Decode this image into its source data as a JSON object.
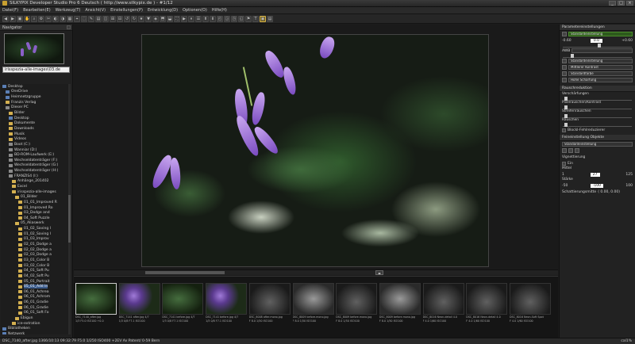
{
  "window": {
    "title": "SILKYPIX Developer Studio Pro 6 Deutsch ( http://www.silkypix.de ) - #1/12",
    "controls": [
      "_",
      "□",
      "×"
    ]
  },
  "menu": [
    "Datei(F)",
    "Bearbeiten(E)",
    "Werkzeug(T)",
    "Ansicht(V)",
    "Einstellungen(P)",
    "Entwicklung(D)",
    "Optionen(O)",
    "Hilfe(H)"
  ],
  "left": {
    "navigator_title": "Navigator",
    "folder_value": "irisspezia-alle-images\\03.de",
    "tree": [
      {
        "label": "Desktop",
        "icon": "b",
        "indent": 0
      },
      {
        "label": "OneDrive",
        "icon": "b",
        "indent": 1
      },
      {
        "label": "Heimnetzgruppe",
        "icon": "b",
        "indent": 1
      },
      {
        "label": "Franzis Verlag",
        "icon": "f",
        "indent": 1
      },
      {
        "label": "Dieser PC",
        "icon": "d",
        "indent": 1
      },
      {
        "label": "Bilder",
        "icon": "f",
        "indent": 2
      },
      {
        "label": "Desktop",
        "icon": "b",
        "indent": 2
      },
      {
        "label": "Dokumente",
        "icon": "f",
        "indent": 2
      },
      {
        "label": "Downloads",
        "icon": "f",
        "indent": 2
      },
      {
        "label": "Musik",
        "icon": "f",
        "indent": 2
      },
      {
        "label": "Videos",
        "icon": "f",
        "indent": 2
      },
      {
        "label": "Boot (C:)",
        "icon": "d",
        "indent": 2
      },
      {
        "label": "Wanniar (D:)",
        "icon": "d",
        "indent": 2
      },
      {
        "label": "BD-ROM-Laufwerk (E:)",
        "icon": "d",
        "indent": 2
      },
      {
        "label": "Wechseldatenträger (F:)",
        "icon": "d",
        "indent": 2
      },
      {
        "label": "Wechseldatenträger (G:)",
        "icon": "d",
        "indent": 2
      },
      {
        "label": "Wechseldatenträger (H:)",
        "icon": "d",
        "indent": 2
      },
      {
        "label": "FRANZIS4 (I:)",
        "icon": "d",
        "indent": 2
      },
      {
        "label": "Anhänge_201402",
        "icon": "f",
        "indent": 3
      },
      {
        "label": "Excel",
        "icon": "f",
        "indent": 3
      },
      {
        "label": "irisspezia-alle-images",
        "icon": "f",
        "indent": 3
      },
      {
        "label": "01_Bilder",
        "icon": "f",
        "indent": 4
      },
      {
        "label": "01_01_Improved R",
        "icon": "f",
        "indent": 5
      },
      {
        "label": "01_Improved Ro",
        "icon": "f",
        "indent": 5
      },
      {
        "label": "03_Dodge and",
        "icon": "f",
        "indent": 5
      },
      {
        "label": "04_Soft Puzzle",
        "icon": "f",
        "indent": 5
      },
      {
        "label": "05_Aliaswerk",
        "icon": "f",
        "indent": 4
      },
      {
        "label": "01_02_Saving I",
        "icon": "f",
        "indent": 5
      },
      {
        "label": "01_02_Saving I",
        "icon": "f",
        "indent": 5
      },
      {
        "label": "01_03_Improv",
        "icon": "f",
        "indent": 5
      },
      {
        "label": "02_01_Dodge a",
        "icon": "f",
        "indent": 5
      },
      {
        "label": "02_02_Dodge a",
        "icon": "f",
        "indent": 5
      },
      {
        "label": "02_03_Dodge a",
        "icon": "f",
        "indent": 5
      },
      {
        "label": "03_01_Color B",
        "icon": "f",
        "indent": 5
      },
      {
        "label": "03_02_Color B",
        "icon": "f",
        "indent": 5
      },
      {
        "label": "04_01_Soft Pu",
        "icon": "f",
        "indent": 5
      },
      {
        "label": "04_02_Soft Pu",
        "icon": "f",
        "indent": 5
      },
      {
        "label": "05_01_Portrait",
        "icon": "f",
        "indent": 5
      },
      {
        "label": "05_01_Add In",
        "icon": "f",
        "indent": 5,
        "selected": true
      },
      {
        "label": "06_01_Achrea",
        "icon": "f",
        "indent": 5
      },
      {
        "label": "06_01_Achrom",
        "icon": "f",
        "indent": 5
      },
      {
        "label": "06_01_Gradie",
        "icon": "f",
        "indent": 5
      },
      {
        "label": "06_01_Gradie",
        "icon": "f",
        "indent": 5
      },
      {
        "label": "06_01_Soft Fo",
        "icon": "f",
        "indent": 5
      },
      {
        "label": "Ebigun",
        "icon": "f",
        "indent": 4
      },
      {
        "label": "ice-extration",
        "icon": "f",
        "indent": 3
      },
      {
        "label": "Bibliotheken",
        "icon": "b",
        "indent": 0
      },
      {
        "label": "Netzwerk",
        "icon": "b",
        "indent": 0
      }
    ]
  },
  "filmstrip": [
    {
      "caption1": "DSC_7140_after.jpg",
      "caption2": "1/3 F5.0 ISO100 +0.0",
      "style": "green",
      "selected": true
    },
    {
      "caption1": "DSC_7141 after.jpg 4/7",
      "caption2": "1/3 0/8 F7.1 ISO100",
      "style": "flower"
    },
    {
      "caption1": "DSC_7141 before.jpg 4/7",
      "caption2": "1/3 0/8 F7.1 ISO100",
      "style": "green"
    },
    {
      "caption1": "DSC_7141 before.jpg 4/7",
      "caption2": "1/3 0/8 F7.1 ISO100",
      "style": "flower"
    },
    {
      "caption1": "DSC_8008 after.mono.jpg",
      "caption2": "F 8.0 1/50 ISO100",
      "style": "dark"
    },
    {
      "caption1": "DSC_8009 before.mono.jpg",
      "caption2": "F 8.0 1/50 ISO100",
      "style": "gray"
    },
    {
      "caption1": "DSC_8009 before.mono.jpg",
      "caption2": "F 8.0 1/50 ISO100",
      "style": "dark"
    },
    {
      "caption1": "DSC_8009 before.mono.jpg",
      "caption2": "F 8.0 1/50 ISO100",
      "style": "gray"
    },
    {
      "caption1": "DSC_8016 Neon-detail 4.0",
      "caption2": "F 4.0 1/60 ISO100",
      "style": "dark"
    },
    {
      "caption1": "DSC_8016 Neon-detail 4.0",
      "caption2": "F 4.0 1/60 ISO100",
      "style": "dark"
    },
    {
      "caption1": "DSC_8016 Neon-Soft Spot",
      "caption2": "F 4.0 1/60 ISO100",
      "style": "dark"
    }
  ],
  "right": {
    "section1": "Parametereinstellungen",
    "preset": "Standardeinstellung",
    "exposure_values": [
      "-0.60",
      "0.0",
      "+0.60"
    ],
    "row_wb": "AWB",
    "dd_color": "Standardeinstellung",
    "dd_contrast": "Mittlerer Kontrast",
    "dd_sharp": "Standardfarbe",
    "dd_noise": "Hohe Schärfung",
    "section2": "Rauschreduktion",
    "noise_labels": [
      "Verschärfungen",
      "Pixelrauschen/Kontrast",
      "Streifenrauschen",
      "Rauschen"
    ],
    "checkbox_label": "Blockl-Fehlreduzierer",
    "section3": "Feineinstellung Objekte",
    "preset2": "Standardeinstellung",
    "vignette_label": "Vignettierung",
    "vignette_on": "Ein",
    "mittel_label": "Mittel",
    "mittel_values": [
      "1",
      "27",
      "125"
    ],
    "starke_label": "Stärke",
    "starke_values": [
      "-50",
      "-100",
      "100"
    ],
    "sch_label": "Schattierungsmitte",
    "sch_value": "( 0.00, 0.00)"
  },
  "status": {
    "left": "DSC_7140_after.jpg  1366/10:13 09:32:79 F5.0  1/250  ISO400  +2EV  Av  Patent/  0-59 Bern",
    "right": "cal1%"
  }
}
